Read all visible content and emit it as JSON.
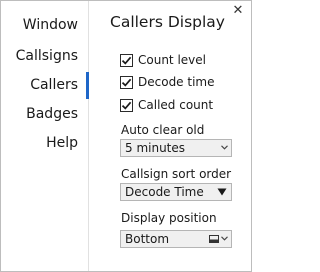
{
  "window": {
    "close_glyph": "✕"
  },
  "nav": {
    "items": [
      {
        "label": "Window",
        "selected": false
      },
      {
        "label": "Callsigns",
        "selected": false
      },
      {
        "label": "Callers",
        "selected": true
      },
      {
        "label": "Badges",
        "selected": false
      },
      {
        "label": "Help",
        "selected": false
      }
    ],
    "accent_color": "#1e66c8"
  },
  "panel": {
    "title": "Callers Display",
    "checkboxes": [
      {
        "label": "Count level",
        "checked": true
      },
      {
        "label": "Decode time",
        "checked": true
      },
      {
        "label": "Called count",
        "checked": true
      }
    ],
    "auto_clear": {
      "label": "Auto clear old",
      "value": "5 minutes",
      "icon": "chevron-down-icon"
    },
    "sort_order": {
      "label": "Callsign sort order",
      "value": "Decode Time",
      "icon": "triangle-down-icon"
    },
    "display_position": {
      "label": "Display position",
      "value": "Bottom",
      "icons": [
        "bottom-position-icon",
        "chevron-down-icon"
      ]
    }
  }
}
